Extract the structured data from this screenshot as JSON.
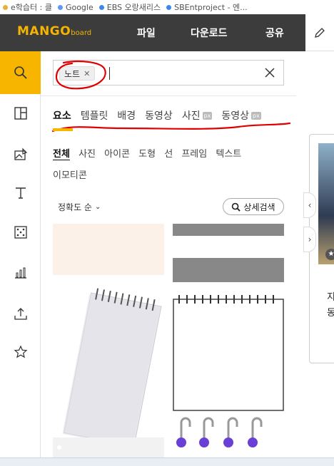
{
  "bookmarks": [
    {
      "label": "e학습터 : 클",
      "color": "#e3a21a"
    },
    {
      "label": "Google",
      "color": "#4285f4"
    },
    {
      "label": "EBS 오랑새리스",
      "color": "#1a73e8"
    },
    {
      "label": "SBEntproject - 엔...",
      "color": "#1a73e8"
    }
  ],
  "header": {
    "logo": "MANGO",
    "logo_suffix": "board",
    "nav": [
      "파일",
      "다운로드",
      "공유"
    ]
  },
  "sidebar": {
    "items": [
      {
        "name": "search-icon",
        "active": true
      },
      {
        "name": "layout-icon"
      },
      {
        "name": "image-edit-icon"
      },
      {
        "name": "text-icon"
      },
      {
        "name": "dice-icon"
      },
      {
        "name": "chart-icon"
      },
      {
        "name": "upload-icon"
      },
      {
        "name": "star-icon"
      }
    ]
  },
  "search": {
    "chip": "노트",
    "value": ""
  },
  "category_tabs": [
    {
      "label": "요소",
      "active": true
    },
    {
      "label": "템플릿"
    },
    {
      "label": "배경"
    },
    {
      "label": "동영상"
    },
    {
      "label": "사진",
      "badge": "px"
    },
    {
      "label": "동영상",
      "badge": "px"
    }
  ],
  "sub_tabs": [
    {
      "label": "전체",
      "active": true
    },
    {
      "label": "사진"
    },
    {
      "label": "아이콘"
    },
    {
      "label": "도형"
    },
    {
      "label": "선"
    },
    {
      "label": "프레임"
    },
    {
      "label": "텍스트"
    },
    {
      "label": "이모티콘"
    }
  ],
  "sort": {
    "label": "정확도 순"
  },
  "advanced_search": {
    "label": "상세검색"
  },
  "right_panel": {
    "text": [
      "지",
      "동"
    ]
  },
  "colors": {
    "accent": "#f7b500",
    "header_bg": "#3c3c3c",
    "annotation": "#e00000"
  }
}
